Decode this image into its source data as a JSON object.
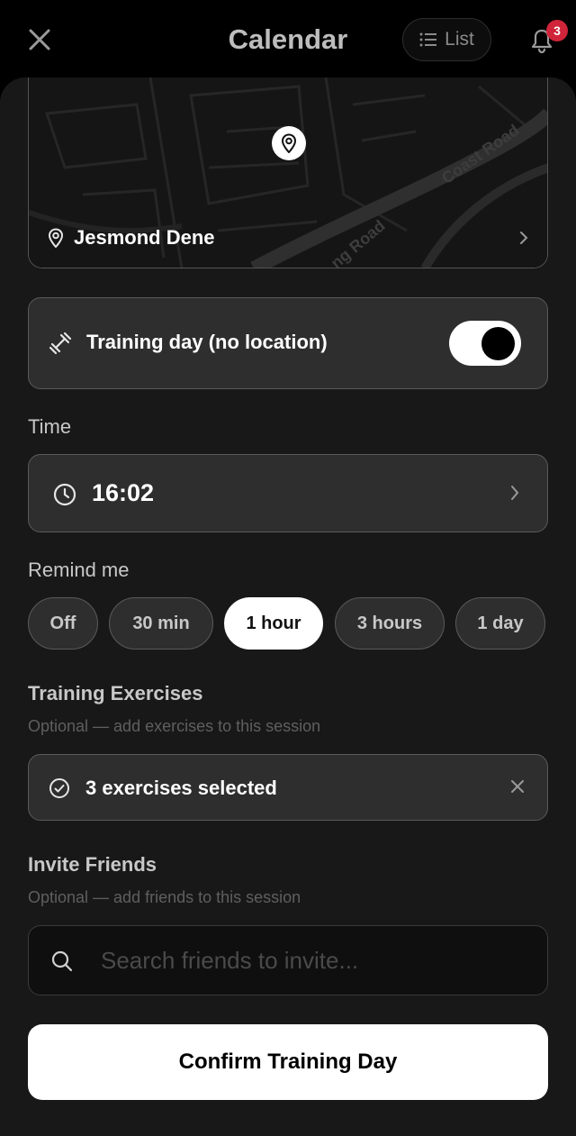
{
  "header": {
    "title": "Calendar",
    "list_label": "List",
    "notification_count": "3"
  },
  "map": {
    "location_name": "Jesmond Dene",
    "road_labels": [
      "Coast Road",
      "ng Road"
    ]
  },
  "training": {
    "label": "Training day (no location)",
    "toggle_on": true
  },
  "time": {
    "section_label": "Time",
    "value": "16:02"
  },
  "reminder": {
    "section_label": "Remind me",
    "options": [
      "Off",
      "30 min",
      "1 hour",
      "3 hours",
      "1 day"
    ],
    "selected": "1 hour"
  },
  "exercises": {
    "heading": "Training Exercises",
    "subtitle": "Optional — add exercises to this session",
    "selected_label": "3 exercises selected"
  },
  "friends": {
    "heading": "Invite Friends",
    "subtitle": "Optional — add friends to this session",
    "search_placeholder": "Search friends to invite..."
  },
  "confirm_label": "Confirm Training Day",
  "colors": {
    "background": "#000000",
    "sheet": "#181818",
    "card": "#2e2e2e",
    "badge": "#d0243a",
    "primary_button": "#ffffff"
  }
}
